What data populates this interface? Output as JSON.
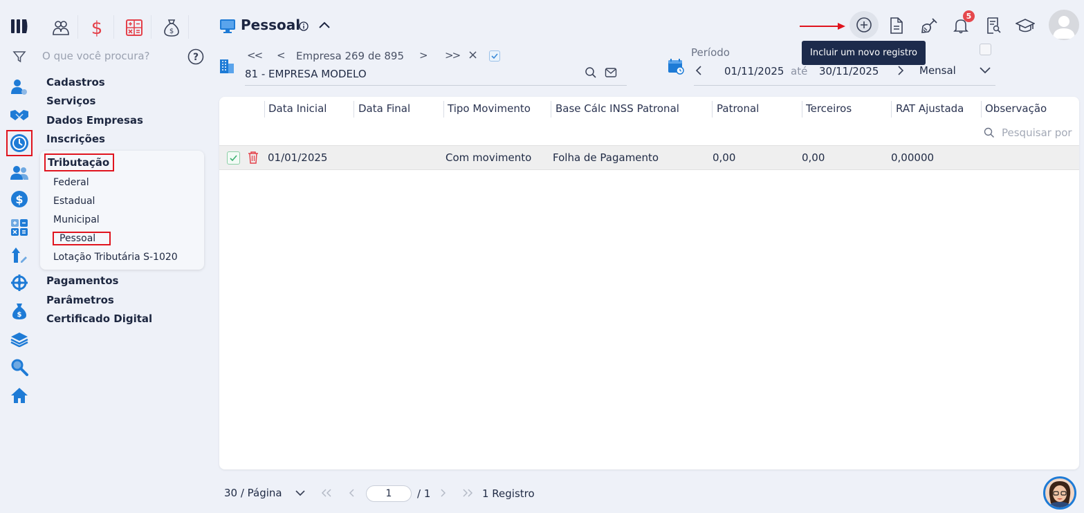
{
  "sidebar": {
    "search_placeholder": "O que você procura?",
    "menu": {
      "cadastros": "Cadastros",
      "servicos": "Serviços",
      "dados_empresas": "Dados Empresas",
      "inscricoes": "Inscrições",
      "tributacao": "Tributação",
      "pagamentos": "Pagamentos",
      "parametros": "Parâmetros",
      "certificado": "Certificado Digital"
    },
    "submenu": {
      "federal": "Federal",
      "estadual": "Estadual",
      "municipal": "Municipal",
      "pessoal": "Pessoal",
      "lotacao": "Lotação Tributária S-1020"
    }
  },
  "header": {
    "title": "Pessoal",
    "notification_count": "5",
    "tooltip": "Incluir um novo registro"
  },
  "company": {
    "nav_label": "Empresa 269 de 895",
    "first": "<<",
    "prev": "<",
    "next": ">",
    "last": ">>",
    "close": "×",
    "selected": "81 - EMPRESA MODELO"
  },
  "period": {
    "label": "Período",
    "start": "01/11/2025",
    "separator": "até",
    "end": "30/11/2025",
    "mode": "Mensal"
  },
  "grid": {
    "columns": [
      "Data Inicial",
      "Data Final",
      "Tipo Movimento",
      "Base Cálc INSS Patronal",
      "Patronal",
      "Terceiros",
      "RAT Ajustada",
      "Observação"
    ],
    "search_placeholder": "Pesquisar por",
    "rows": [
      {
        "data_inicial": "01/01/2025",
        "data_final": "",
        "tipo_movimento": "Com movimento",
        "base_calc": "Folha de Pagamento",
        "patronal": "0,00",
        "terceiros": "0,00",
        "rat": "0,00000",
        "observacao": ""
      }
    ]
  },
  "footer": {
    "per_page": "30 / Página",
    "page_current": "1",
    "page_total": "/ 1",
    "record_count": "1 Registro"
  }
}
